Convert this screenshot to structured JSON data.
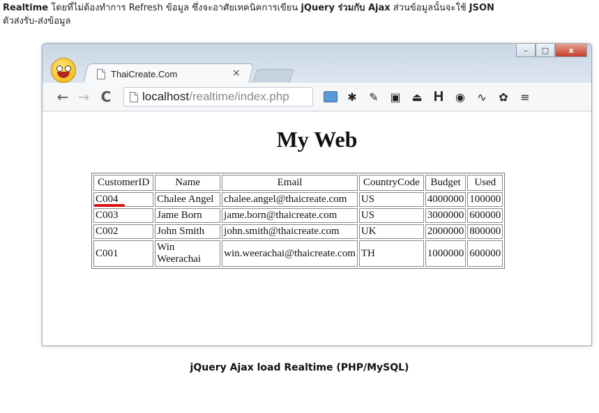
{
  "intro": {
    "line1_a": "Realtime",
    "line1_b": " โดยที่ไม่ต้องทำการ Refresh ข้อมูล ซึ่งจะอาศัยเทคนิคการเขียน ",
    "line1_c": "jQuery ร่วมกับ Ajax",
    "line1_d": " ส่วนข้อมูลนั้นจะใช้ ",
    "line1_e": "JSON",
    "line2": "ตัวส่งรับ-ส่งข้อมูล"
  },
  "browser": {
    "tab_title": "ThaiCreate.Com",
    "tab_close": "×",
    "url_host": "localhost",
    "url_path": "/realtime/index.php",
    "win_min": "–",
    "win_max": "□",
    "win_close": "x"
  },
  "page": {
    "heading": "My Web",
    "table": {
      "headers": [
        "CustomerID",
        "Name",
        "Email",
        "CountryCode",
        "Budget",
        "Used"
      ],
      "rows": [
        [
          "C004",
          "Chalee Angel",
          "chalee.angel@thaicreate.com",
          "US",
          "4000000",
          "100000"
        ],
        [
          "C003",
          "Jame Born",
          "jame.born@thaicreate.com",
          "US",
          "3000000",
          "600000"
        ],
        [
          "C002",
          "John Smith",
          "john.smith@thaicreate.com",
          "UK",
          "2000000",
          "800000"
        ],
        [
          "C001",
          "Win Weerachai",
          "win.weerachai@thaicreate.com",
          "TH",
          "1000000",
          "600000"
        ]
      ]
    }
  },
  "caption": "jQuery Ajax load Realtime (PHP/MySQL)",
  "icons": {
    "back": "back-arrow-icon",
    "forward": "forward-arrow-icon",
    "reload": "reload-icon",
    "menu": "hamburger-menu-icon",
    "settings": "gear-icon"
  },
  "colors": {
    "underline": "#dd1111",
    "titlebar": "#c9d6e4"
  }
}
